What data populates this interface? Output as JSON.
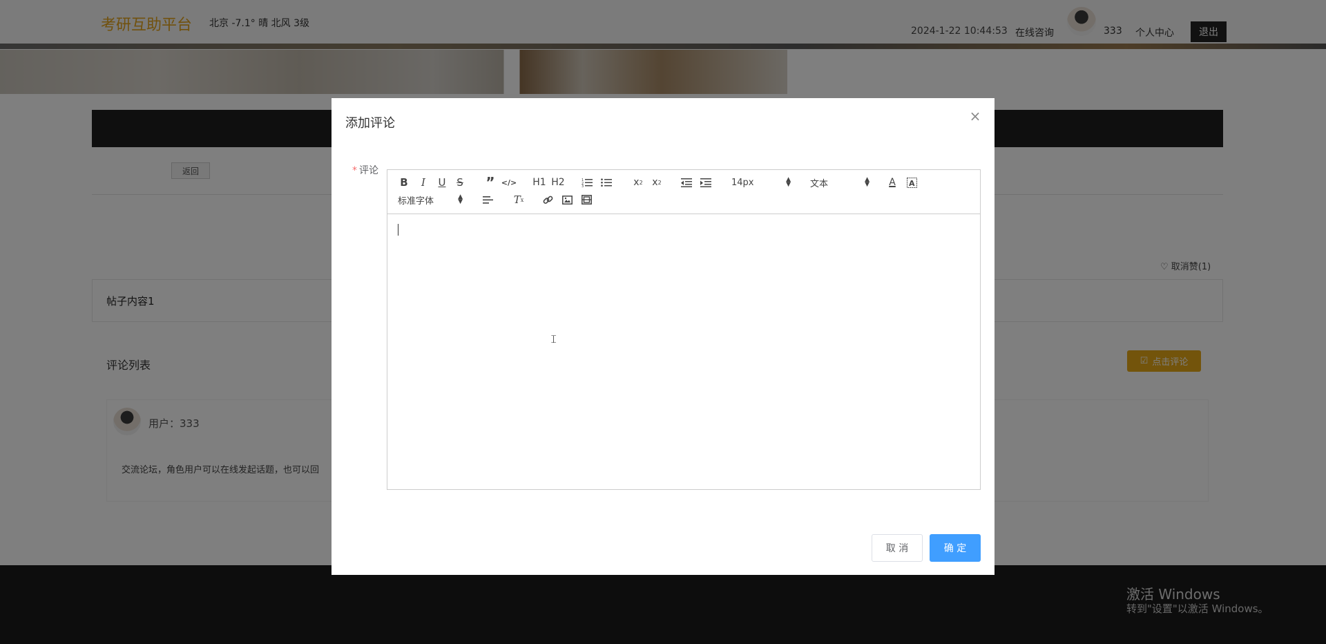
{
  "header": {
    "brand": "考研互助平台",
    "weather": "北京  -7.1°  晴  北风  3级",
    "datetime": "2024-1-22 10:44:53",
    "nav_consult": "在线咨询",
    "username": "333",
    "nav_profile": "个人中心",
    "logout_label": "退出"
  },
  "page": {
    "back_label": "返回",
    "like_label": "取消赞(1)",
    "post_content": "帖子内容1",
    "comment_list_title": "评论列表",
    "comment_button_label": "点击评论",
    "comment": {
      "user": "用户：333",
      "text": "交流论坛，角色用户可以在线发起话题，也可以回"
    }
  },
  "os_watermark": {
    "line1": "激活 Windows",
    "line2": "转到\"设置\"以激活 Windows。"
  },
  "modal": {
    "title": "添加评论",
    "close_glyph": "×",
    "field_label": "评论",
    "required_mark": "*",
    "toolbar": {
      "font_size": "14px",
      "header_select": "文本",
      "font_family": "标准字体",
      "h1": "H1",
      "h2": "H2"
    },
    "cancel_label": "取 消",
    "ok_label": "确 定"
  },
  "colors": {
    "brand": "#e3a21a",
    "primary_button": "#409eff",
    "comment_button": "#e6a817",
    "required": "#f56c6c"
  }
}
